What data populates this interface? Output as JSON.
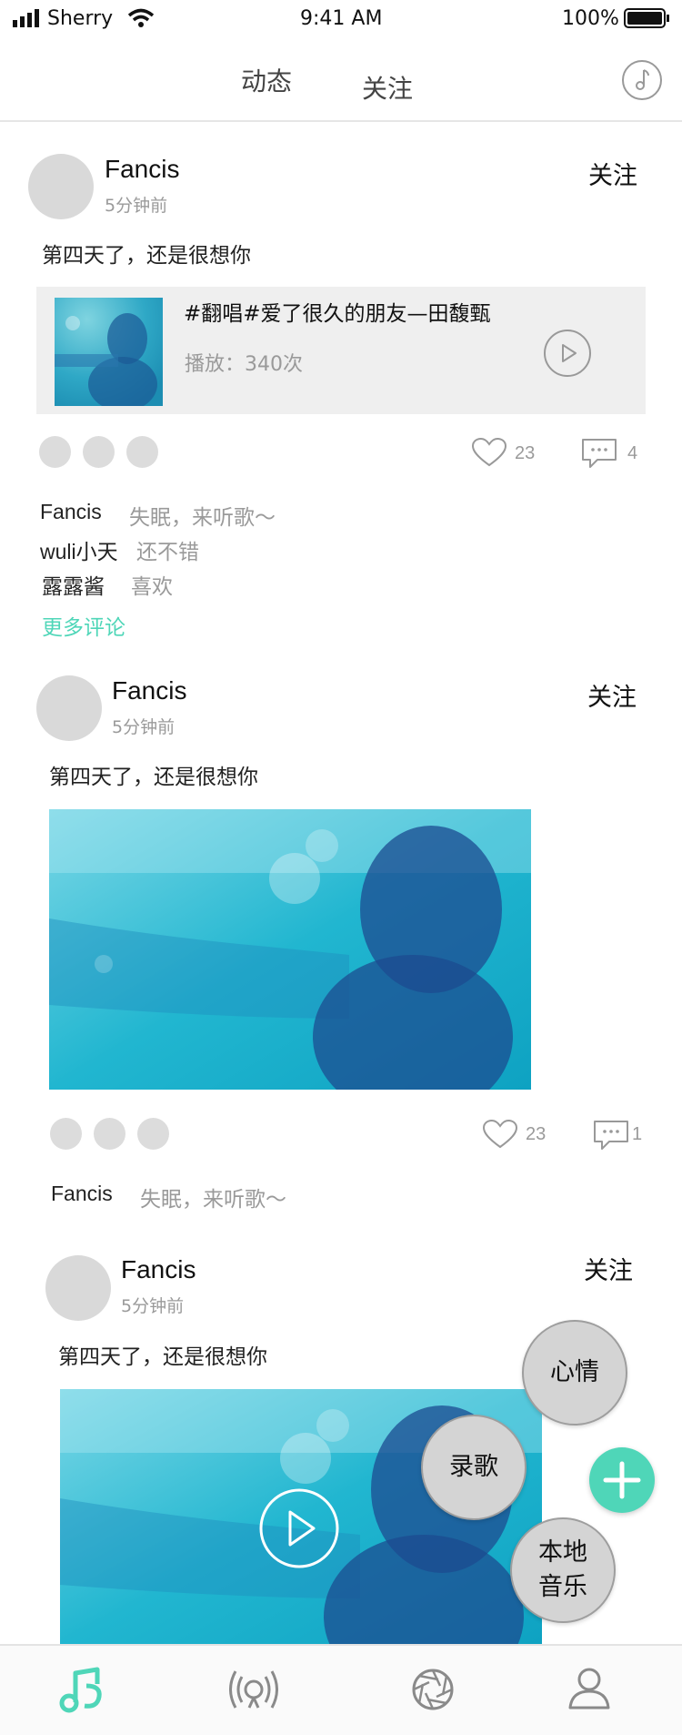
{
  "status_bar": {
    "carrier": "Sherry",
    "time": "9:41 AM",
    "battery": "100%"
  },
  "header": {
    "tabs": [
      {
        "label": "动态"
      },
      {
        "label": "关注"
      }
    ],
    "music_icon": "music-note-icon"
  },
  "posts": [
    {
      "name": "Fancis",
      "time": "5分钟前",
      "follow": "关注",
      "content": "第四天了，还是很想你",
      "music": {
        "title": "#翻唱#爱了很久的朋友—田馥甄",
        "plays": "播放：340次"
      },
      "likes": "23",
      "comments_count": "4",
      "comments": [
        {
          "user": "Fancis",
          "text": "失眠，来听歌～"
        },
        {
          "user": "wuli小天",
          "text": "还不错"
        },
        {
          "user": "露露酱",
          "text": "喜欢"
        }
      ],
      "more_comments": "更多评论"
    },
    {
      "name": "Fancis",
      "time": "5分钟前",
      "follow": "关注",
      "content": "第四天了，还是很想你",
      "likes": "23",
      "comments_count": "1",
      "comments": [
        {
          "user": "Fancis",
          "text": "失眠，来听歌～"
        }
      ]
    },
    {
      "name": "Fancis",
      "time": "5分钟前",
      "follow": "关注",
      "content": "第四天了，还是很想你"
    }
  ],
  "fab_menu": [
    {
      "label": "心情"
    },
    {
      "label": "录歌"
    },
    {
      "label": "本地音乐"
    }
  ],
  "bottom_tabs": [
    "music-notes-icon",
    "radio-broadcast-icon",
    "aperture-icon",
    "user-icon"
  ],
  "colors": {
    "accent": "#4fd6b8",
    "card_bg": "#efefef",
    "avatar": "#d9d9d9"
  }
}
